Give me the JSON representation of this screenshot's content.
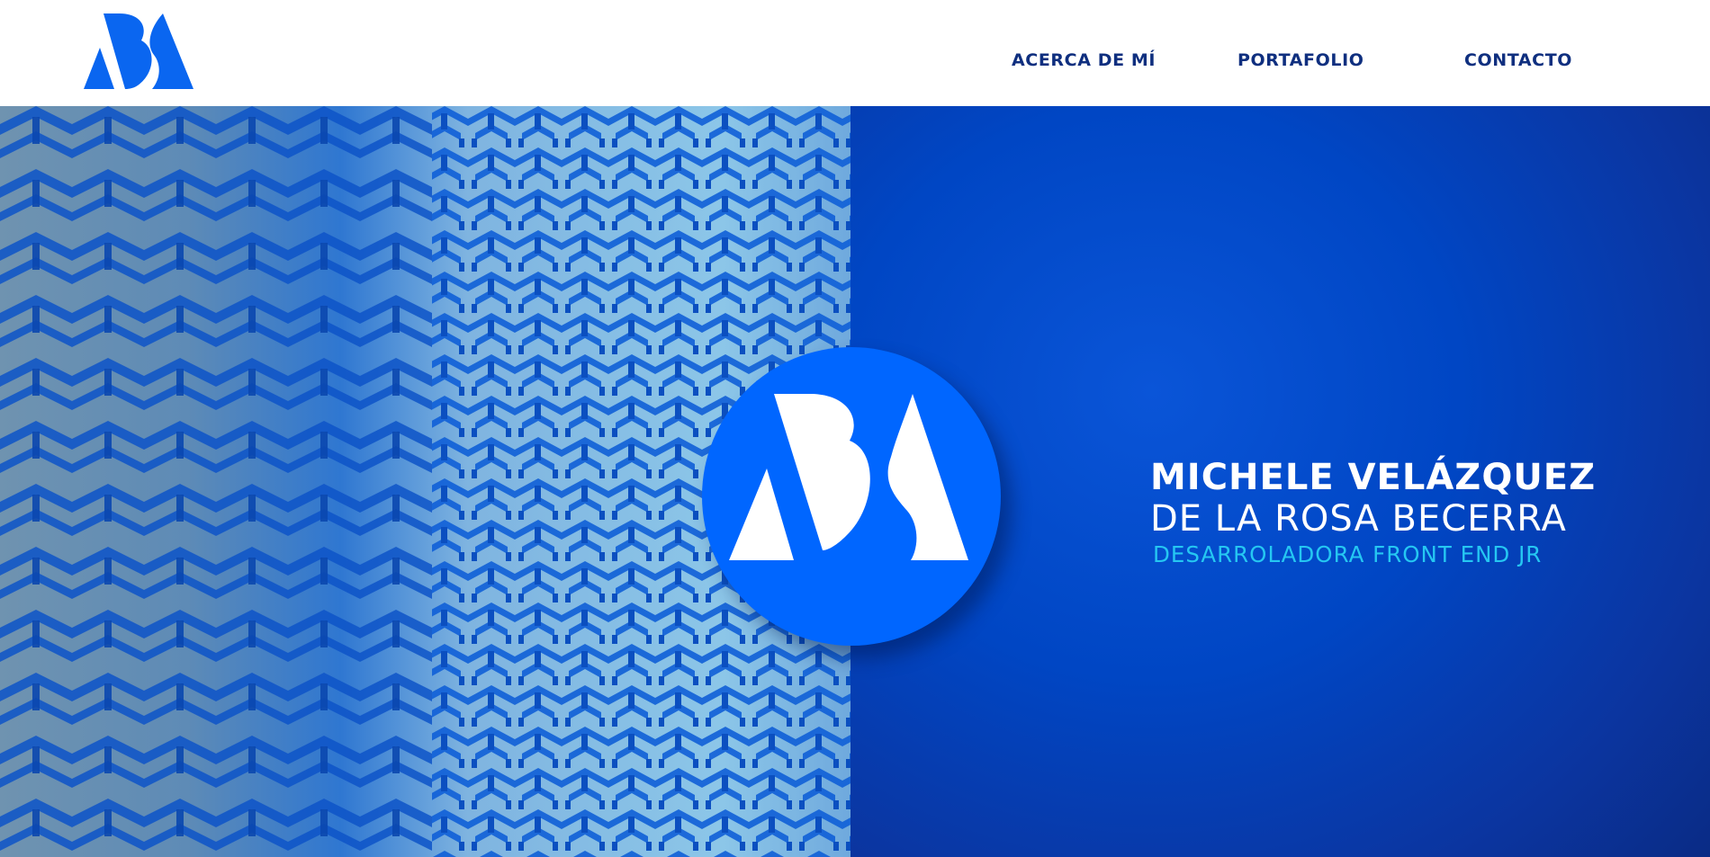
{
  "brand": {
    "logo_icon": "ab-monogram-logo",
    "accent_color": "#0066ff"
  },
  "nav": {
    "items": [
      {
        "label": "ACERCA DE MÍ"
      },
      {
        "label": "PORTAFOLIO"
      },
      {
        "label": "CONTACTO"
      }
    ],
    "text_color": "#0f2f7f"
  },
  "hero": {
    "name_line1": "MICHELE VELÁZQUEZ",
    "name_line2": "DE LA ROSA BECERRA",
    "role": "DESARROLADORA FRONT END JR",
    "role_color": "#25c7f2",
    "background_color": "#0046c4",
    "pattern": "isometric-maze-pattern",
    "center_logo_icon": "ab-monogram-circle-logo"
  }
}
